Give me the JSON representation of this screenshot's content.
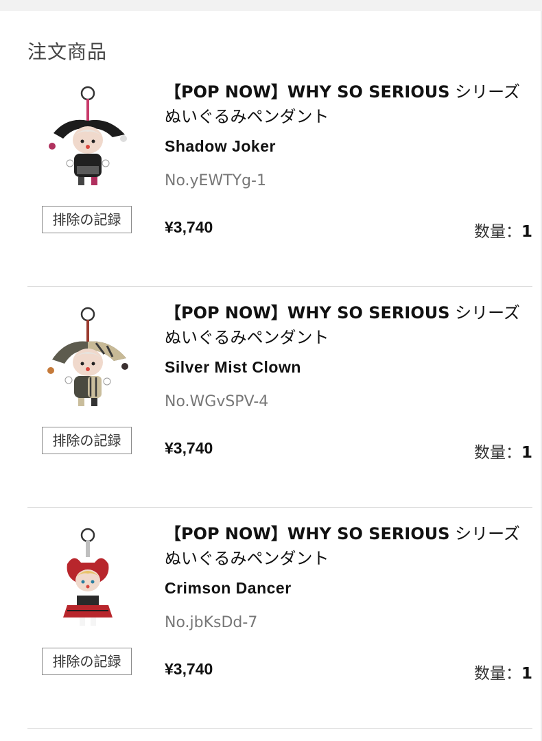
{
  "order": {
    "section_title": "注文商品",
    "exclude_label": "排除の記録",
    "qty_label": "数量：",
    "items": [
      {
        "title_en": "【POP NOW】WHY SO SERIOUS",
        "title_jp": " シリーズ ぬいぐるみペンダント",
        "variant": "Shadow Joker",
        "sku": "No.yEWTYg-1",
        "price": "¥3,740",
        "qty": "1"
      },
      {
        "title_en": "【POP NOW】WHY SO SERIOUS",
        "title_jp": " シリーズ ぬいぐるみペンダント",
        "variant": "Silver Mist Clown",
        "sku": "No.WGvSPV-4",
        "price": "¥3,740",
        "qty": "1"
      },
      {
        "title_en": "【POP NOW】WHY SO SERIOUS",
        "title_jp": " シリーズ ぬいぐるみペンダント",
        "variant": "Crimson Dancer",
        "sku": "No.jbKsDd-7",
        "price": "¥3,740",
        "qty": "1"
      }
    ]
  },
  "colors": {
    "text": "#111111",
    "muted": "#777777",
    "divider": "#dddddd"
  }
}
